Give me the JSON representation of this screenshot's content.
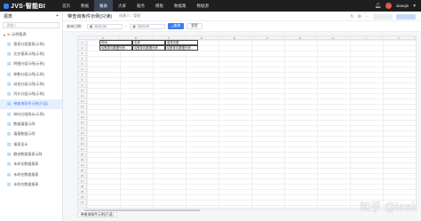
{
  "app": {
    "title": "JVS·智能BI"
  },
  "nav": [
    "首页",
    "数据",
    "报表",
    "大屏",
    "服务",
    "模板",
    "数据集",
    "数据源"
  ],
  "nav_active": 2,
  "user": {
    "name": "xiaoqin"
  },
  "sidebar": {
    "heading": "报表",
    "search_placeholder": "请输入",
    "root": "示例报表",
    "items": [
      "报表分组报表(示例)",
      "交叉报表示例(示例)",
      "明细分组示例(示例)",
      "参数分组示例(示例)",
      "动态分组示例(示例)",
      "列头分组示例(示例)",
      "带查询条件示例(只读)",
      "纵向分组统计(示例)",
      "数据填报示例",
      "填报数据示例",
      "报表设计",
      "静态数据报表示例",
      "未命名数据报表",
      "未命名数据报表",
      "未命名数据报表"
    ],
    "selected_index": 6
  },
  "page": {
    "title": "带查询条件示例(只读)",
    "creator": "创建人：管理"
  },
  "filter": {
    "label": "查询日期：",
    "start": "2023-06",
    "end": "2023-09",
    "query_label": "查询",
    "reset_label": "重置"
  },
  "sheet": {
    "columns": [
      "A",
      "B",
      "C",
      "D",
      "E",
      "F",
      "G",
      "H",
      "I",
      "J"
    ],
    "rows": [
      "1",
      "2",
      "3",
      "4",
      "5",
      "6",
      "7",
      "8",
      "9",
      "10",
      "11",
      "12",
      "13",
      "14",
      "15",
      "16",
      "17",
      "18",
      "19",
      "20",
      "21",
      "22",
      "23",
      "24",
      "25",
      "26",
      "27",
      "28",
      "29",
      "30",
      "31"
    ],
    "cells": [
      [
        "时间",
        "名称",
        "登录次数"
      ],
      [
        "${登录月数据分析...",
        "${登录月数据分析...",
        "${登录月数据分析..."
      ]
    ],
    "tab": "带查询条件示例(只读)"
  },
  "watermark": "知乎 @leek",
  "colors": {
    "accent": "#3d7cf7",
    "topbar": "#1f1f22",
    "selected_bg": "#e6efff"
  }
}
